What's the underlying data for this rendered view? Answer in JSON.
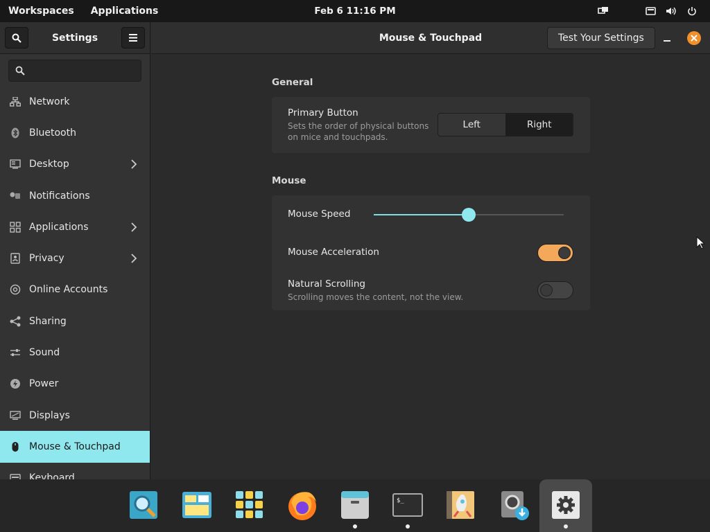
{
  "topbar": {
    "workspaces": "Workspaces",
    "applications": "Applications",
    "clock": "Feb 6  11:16 PM"
  },
  "sidebar": {
    "title": "Settings",
    "search_placeholder": "",
    "items": [
      {
        "label": "Network",
        "icon": "network-icon"
      },
      {
        "label": "Bluetooth",
        "icon": "bluetooth-icon"
      },
      {
        "label": "Desktop",
        "icon": "desktop-icon"
      },
      {
        "label": "Notifications",
        "icon": "notifications-icon"
      },
      {
        "label": "Applications",
        "icon": "applications-icon"
      },
      {
        "label": "Privacy",
        "icon": "privacy-icon"
      },
      {
        "label": "Online Accounts",
        "icon": "at-icon"
      },
      {
        "label": "Sharing",
        "icon": "share-icon"
      },
      {
        "label": "Sound",
        "icon": "sound-icon"
      },
      {
        "label": "Power",
        "icon": "power-icon"
      },
      {
        "label": "Displays",
        "icon": "displays-icon"
      },
      {
        "label": "Mouse & Touchpad",
        "icon": "mouse-icon"
      },
      {
        "label": "Keyboard",
        "icon": "keyboard-icon"
      }
    ],
    "active_index": 11
  },
  "main": {
    "title": "Mouse & Touchpad",
    "test_button": "Test Your Settings",
    "general": {
      "section_title": "General",
      "primary_button": {
        "label": "Primary Button",
        "desc_line1": "Sets the order of physical buttons",
        "desc_line2": "on mice and touchpads.",
        "options": [
          "Left",
          "Right"
        ],
        "selected": "Right"
      }
    },
    "mouse": {
      "section_title": "Mouse",
      "speed": {
        "label": "Mouse Speed",
        "value_fraction": 0.5
      },
      "acceleration": {
        "label": "Mouse Acceleration",
        "enabled": true
      },
      "natural_scrolling": {
        "label": "Natural Scrolling",
        "desc": "Scrolling moves the content, not the view.",
        "enabled": false
      }
    }
  },
  "dock": {
    "items": [
      {
        "name": "search-app-icon",
        "running": false
      },
      {
        "name": "files-manager-icon",
        "running": false
      },
      {
        "name": "app-grid-icon",
        "running": false
      },
      {
        "name": "firefox-icon",
        "running": false
      },
      {
        "name": "file-cabinet-icon",
        "running": true
      },
      {
        "name": "terminal-icon",
        "running": true
      },
      {
        "name": "launcher-rocket-icon",
        "running": false
      },
      {
        "name": "backup-download-icon",
        "running": false
      },
      {
        "name": "settings-gear-icon",
        "running": true
      }
    ]
  },
  "colors": {
    "accent": "#8fe8ee",
    "toggle_on": "#f4a85a",
    "close": "#f0902b"
  }
}
